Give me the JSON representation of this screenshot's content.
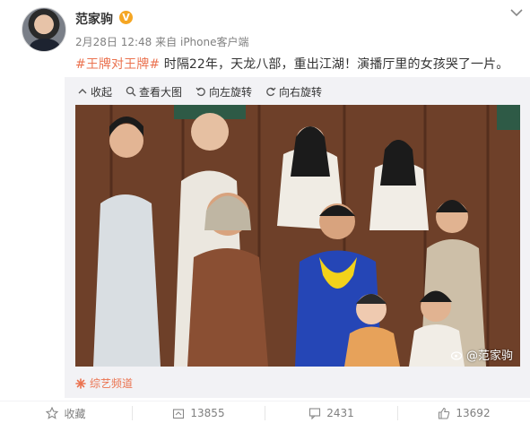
{
  "post": {
    "username": "范家驹",
    "verified_badge": "V",
    "timestamp": "2月28日 12:48",
    "source_prefix": "来自",
    "source": "iPhone客户端",
    "hashtag": "#王牌对王牌#",
    "text": " 时隔22年，天龙八部，重出江湖！演播厅里的女孩哭了一片。"
  },
  "media_toolbar": {
    "collapse": "收起",
    "view_large": "查看大图",
    "rotate_left": "向左旋转",
    "rotate_right": "向右旋转"
  },
  "photo": {
    "watermark": "@范家驹"
  },
  "channel": {
    "label": "综艺频道"
  },
  "actions": {
    "favorite": "收藏",
    "repost_count": "13855",
    "comment_count": "2431",
    "like_count": "13692"
  },
  "colors": {
    "accent": "#eb7350",
    "verified": "#f5a623",
    "muted": "#808080"
  }
}
